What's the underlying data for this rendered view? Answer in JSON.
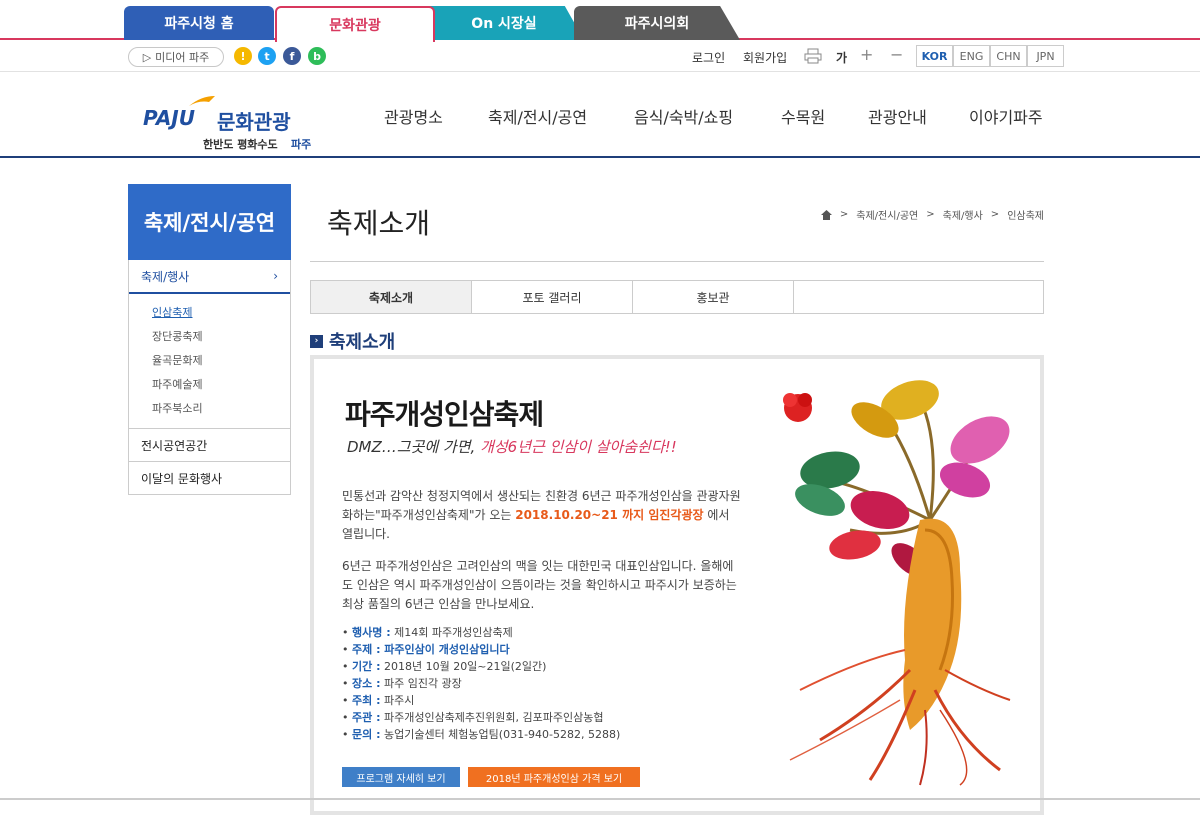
{
  "top_tabs": [
    "파주시청 홈",
    "문화관광",
    "On 시장실",
    "파주시의회"
  ],
  "util": {
    "media_label": "미디어 파주",
    "login": "로그인",
    "join": "회원가입",
    "font_label": "가",
    "plus": "+",
    "minus": "−",
    "languages": [
      "KOR",
      "ENG",
      "CHN",
      "JPN"
    ]
  },
  "logo": {
    "brand": "PAJU",
    "name": "문화관광",
    "slogan_part": "한반도 평화수도",
    "slogan_city": "파주"
  },
  "nav": [
    "관광명소",
    "축제/전시/공연",
    "음식/숙박/쇼핑",
    "수목원",
    "관광안내",
    "이야기파주"
  ],
  "sidebar": {
    "title": "축제/전시/공연",
    "main_item": "축제/행사",
    "main_arrow": "›",
    "subitems": [
      "인삼축제",
      "장단콩축제",
      "율곡문화제",
      "파주예술제",
      "파주북소리"
    ],
    "other_items": [
      "전시공연공간",
      "이달의 문화행사"
    ]
  },
  "page": {
    "title": "축제소개",
    "breadcrumb": [
      "축제/전시/공연",
      "축제/행사",
      "인삼축제"
    ],
    "breadcrumb_sep": ">",
    "sub_tabs": [
      "축제소개",
      "포토 갤러리",
      "홍보관"
    ],
    "section_title": "축제소개"
  },
  "festival": {
    "title": "파주개성인삼축제",
    "slogan_a": "DMZ…그곳에 가면, ",
    "slogan_b": "개성6년근 인삼이 살아숨쉰다!!",
    "p1a": "민통선과 감악산 청정지역에서 생산되는 친환경 6년근 파주개성인삼을 관광자원화하는\"파주개성인삼축제\"가 오는 ",
    "p1b": "2018.10.20~21 까지 임진각광장",
    "p1c": " 에서 열립니다.",
    "p2": "6년근 파주개성인삼은 고려인삼의 맥을 잇는 대한민국 대표인삼입니다. 올해에도 인삼은 역시 파주개성인삼이 으뜸이라는 것을 확인하시고 파주시가 보증하는 최상 품질의 6년근 인삼을 만나보세요.",
    "info": [
      {
        "k": "행사명 :",
        "v": " 제14회 파주개성인삼축제"
      },
      {
        "k": "주제 :",
        "v": " 파주인삼이 개성인삼입니다"
      },
      {
        "k": "기간 :",
        "v": " 2018년 10월 20일~21일(2일간)"
      },
      {
        "k": "장소 :",
        "v": " 파주 임진각 광장"
      },
      {
        "k": "주최 :",
        "v": " 파주시"
      },
      {
        "k": "주관 :",
        "v": " 파주개성인삼축제추진위원회, 김포파주인삼농협"
      },
      {
        "k": "문의 :",
        "v": " 농업기술센터 체험농업팀(031-940-5282, 5288)"
      }
    ],
    "btn_program": "프로그램 자세히 보기",
    "btn_price": "2018년 파주개성인삼 가격 보기"
  },
  "colors": {
    "accent_pink": "#d8385e",
    "navy": "#1f3f7a",
    "blue": "#2f6bc8",
    "orange": "#f07020"
  }
}
